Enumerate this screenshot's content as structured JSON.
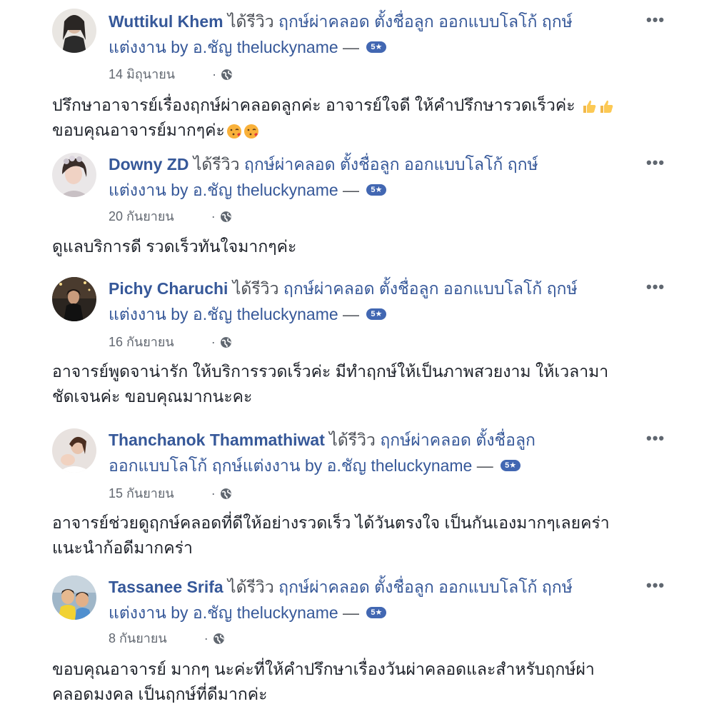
{
  "reviews": [
    {
      "name": "Wuttikul Khem",
      "action": " ได้รีวิว ",
      "page_line1": "ฤกษ์ผ่าคลอด ตั้งชื่อลูก ออกแบบโลโก้ ฤกษ์",
      "page_line2": "แต่งงาน by อ.ชัญ theluckyname",
      "dash": " — ",
      "rating": "5★",
      "date": "14 มิถุนายน",
      "dot": "·",
      "text": "ปรึกษาอาจารย์เรื่องฤกษ์ผ่าคลอดลูกค่ะ อาจารย์ใจดี ให้คำปรึกษารวดเร็วค่ะ",
      "text2": "ขอบคุณอาจารย์มากๆค่ะ"
    },
    {
      "name": "Downy ZD",
      "action": " ได้รีวิว ",
      "page_line1": "ฤกษ์ผ่าคลอด ตั้งชื่อลูก ออกแบบโลโก้ ฤกษ์",
      "page_line2": "แต่งงาน by อ.ชัญ theluckyname",
      "dash": " — ",
      "rating": "5★",
      "date": "20 กันยายน",
      "dot": "·",
      "text": "ดูแลบริการดี รวดเร็วทันใจมากๆค่ะ"
    },
    {
      "name": "Pichy Charuchi",
      "action": " ได้รีวิว ",
      "page_line1": "ฤกษ์ผ่าคลอด ตั้งชื่อลูก ออกแบบโลโก้ ฤกษ์",
      "page_line2": "แต่งงาน by อ.ชัญ theluckyname",
      "dash": " — ",
      "rating": "5★",
      "date": "16 กันยายน",
      "dot": "·",
      "text": "อาจารย์พูดจาน่ารัก ให้บริการรวดเร็วค่ะ มีทำฤกษ์ให้เป็นภาพสวยงาม ให้เวลามา",
      "text2": "ชัดเจนค่ะ ขอบคุณมากนะคะ"
    },
    {
      "name": "Thanchanok Thammathiwat",
      "action": " ได้รีวิว ",
      "page_line1": "ฤกษ์ผ่าคลอด ตั้งชื่อลูก",
      "page_line2": "ออกแบบโลโก้ ฤกษ์แต่งงาน by อ.ชัญ theluckyname",
      "dash": " — ",
      "rating": "5★",
      "date": "15 กันยายน",
      "dot": "·",
      "text": "อาจารย์ช่วยดูฤกษ์คลอดที่ดีให้อย่างรวดเร็ว ได้วันตรงใจ เป็นกันเองมากๆเลยคร่า",
      "text2": "แนะนำก้อดีมากคร่า"
    },
    {
      "name": "Tassanee Srifa",
      "action": " ได้รีวิว ",
      "page_line1": "ฤกษ์ผ่าคลอด ตั้งชื่อลูก ออกแบบโลโก้ ฤกษ์",
      "page_line2": "แต่งงาน by อ.ชัญ theluckyname",
      "dash": " — ",
      "rating": "5★",
      "date": "8 กันยายน",
      "dot": "·",
      "text": "ขอบคุณอาจารย์ มากๆ นะค่ะที่ให้คำปรึกษาเรื่องวันผ่าคลอดและสำหรับฤกษ์ผ่า",
      "text2": "คลอดมงคล เป็นฤกษ์ที่ดีมากค่ะ"
    }
  ],
  "icons": {
    "more": "•••",
    "globe": "globe-icon",
    "thumbs_up": "thumbs-up-emoji",
    "kiss": "kissing-face-emoji"
  },
  "colors": {
    "link": "#365899",
    "badge": "#4267b2",
    "meta": "#616770",
    "text": "#1d2129"
  }
}
